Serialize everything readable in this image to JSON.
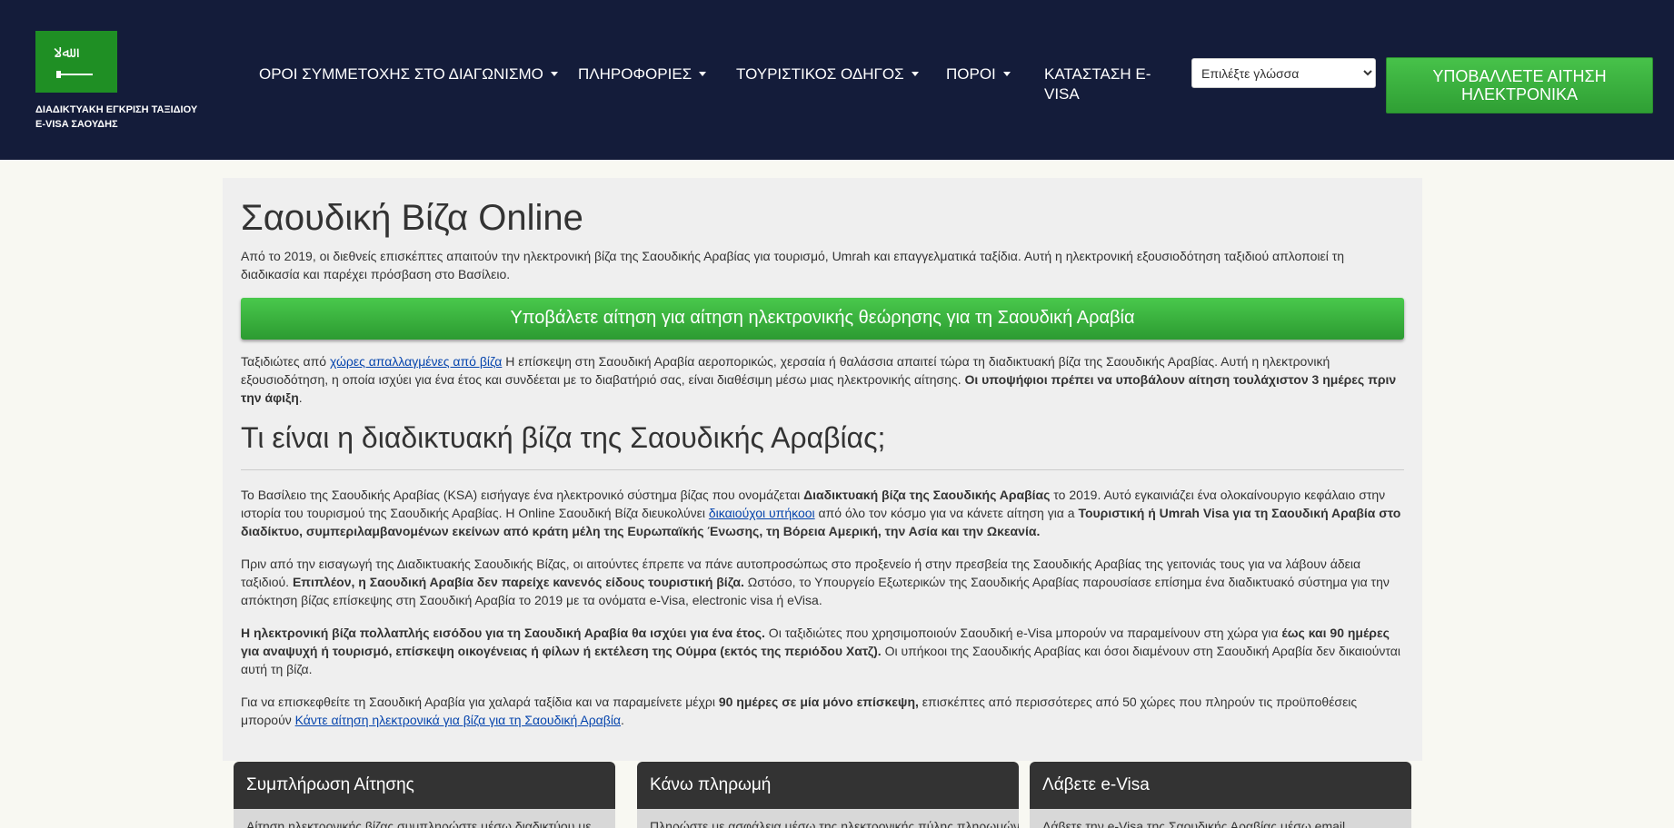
{
  "header": {
    "brand_text": "ΔΙΑΔΙΚΤΥΑΚΗ ΕΓΚΡΙΣΗ ΤΑΞΙΔΙΟΥ E-VISA ΣΑΟΥΔΗΣ",
    "nav": [
      {
        "label": "ΟΡΟΙ ΣΥΜΜΕΤΟΧΗΣ ΣΤΟ ΔΙΑΓΩΝΙΣΜΟ"
      },
      {
        "label": "ΠΛΗΡΟΦΟΡΙΕΣ"
      },
      {
        "label": "ΤΟΥΡΙΣΤΙΚΟΣ ΟΔΗΓΟΣ"
      },
      {
        "label": "ΠΟΡΟΙ"
      },
      {
        "label": "ΚΑΤΑΣΤΑΣΗ E-VISA"
      }
    ],
    "language_select": "Επιλέξτε γλώσσα",
    "apply_button": "ΥΠΟΒΑΛΛΕΤΕ ΑΙΤΗΣΗ ΗΛΕΚΤΡΟΝΙΚΑ",
    "colors": {
      "background": "#141c3a",
      "accent_green": "#35a63a"
    }
  },
  "main": {
    "title": "Σαουδική Βίζα Online",
    "intro": "Από το 2019, οι διεθνείς επισκέπτες απαιτούν την ηλεκτρονική βίζα της Σαουδικής Αραβίας για τουρισμό, Umrah και επαγγελματικά ταξίδια. Αυτή η ηλεκτρονική εξουσιοδότηση ταξιδιού απλοποιεί τη διαδικασία και παρέχει πρόσβαση στο Βασίλειο.",
    "apply_big_button": "Υποβάλετε αίτηση για αίτηση ηλεκτρονικής θεώρησης για τη Σαουδική Αραβία",
    "p2": {
      "pre": "Ταξιδιώτες από ",
      "link": "χώρες απαλλαγμένες από βίζα",
      "mid": " Η επίσκεψη στη Σαουδική Αραβία αεροπορικώς, χερσαία ή θαλάσσια απαιτεί τώρα τη διαδικτυακή βίζα της Σαουδικής Αραβίας. Αυτή η ηλεκτρονική εξουσιοδότηση, η οποία ισχύει για ένα έτος και συνδέεται με το διαβατήριό σας, είναι διαθέσιμη μέσω μιας ηλεκτρονικής αίτησης. ",
      "bold": "Οι υποψήφιοι πρέπει να υποβάλουν αίτηση τουλάχιστον 3 ημέρες πριν την άφιξη",
      "end": "."
    },
    "section_title": "Τι είναι η διαδικτυακή βίζα της Σαουδικής Αραβίας;",
    "p3": {
      "a": "Το Βασίλειο της Σαουδικής Αραβίας (KSA) εισήγαγε ένα ηλεκτρονικό σύστημα βίζας που ονομάζεται ",
      "b_bold": "Διαδικτυακή βίζα της Σαουδικής Αραβίας",
      "c": " το 2019. Αυτό εγκαινιάζει ένα ολοκαίνουργιο κεφάλαιο στην ιστορία του τουρισμού της Σαουδικής Αραβίας. Η Online Σαουδική Βίζα διευκολύνει ",
      "d_link": "δικαιούχοι υπήκοοι",
      "e": " από όλο τον κόσμο για να κάνετε αίτηση για a ",
      "f_bold": "Τουριστική ή Umrah Visa για τη Σαουδική Αραβία στο διαδίκτυο, συμπεριλαμβανομένων εκείνων από κράτη μέλη της Ευρωπαϊκής Ένωσης, τη Βόρεια Αμερική, την Ασία και την Ωκεανία."
    },
    "p4": {
      "a": "Πριν από την εισαγωγή της Διαδικτυακής Σαουδικής Βίζας, οι αιτούντες έπρεπε να πάνε αυτοπροσώπως στο προξενείο ή στην πρεσβεία της Σαουδικής Αραβίας της γειτονιάς τους για να λάβουν άδεια ταξιδιού. ",
      "b_bold": "Επιπλέον, η Σαουδική Αραβία δεν παρείχε κανενός είδους τουριστική βίζα.",
      "c": " Ωστόσο, το Υπουργείο Εξωτερικών της Σαουδικής Αραβίας παρουσίασε επίσημα ένα διαδικτυακό σύστημα για την απόκτηση βίζας επίσκεψης στη Σαουδική Αραβία το 2019 με τα ονόματα e-Visa, electronic visa ή eVisa."
    },
    "p5": {
      "a_bold": "Η ηλεκτρονική βίζα πολλαπλής εισόδου για τη Σαουδική Αραβία θα ισχύει για ένα έτος.",
      "b": " Οι ταξιδιώτες που χρησιμοποιούν Σαουδική e-Visa μπορούν να παραμείνουν στη χώρα για ",
      "c_bold": "έως και 90 ημέρες για αναψυχή ή τουρισμό, επίσκεψη οικογένειας ή φίλων ή εκτέλεση της Ούμρα (εκτός της περιόδου Χατζ).",
      "d": " Οι υπήκοοι της Σαουδικής Αραβίας και όσοι διαμένουν στη Σαουδική Αραβία δεν δικαιούνται αυτή τη βίζα."
    },
    "p6": {
      "a": "Για να επισκεφθείτε τη Σαουδική Αραβία για χαλαρά ταξίδια και να παραμείνετε μέχρι ",
      "b_bold": "90 ημέρες σε μία μόνο επίσκεψη,",
      "c": " επισκέπτες από περισσότερες από 50 χώρες που πληρούν τις προϋποθέσεις μπορούν ",
      "d_link": "Κάντε αίτηση ηλεκτρονικά για βίζα για τη Σαουδική Αραβία",
      "e": "."
    }
  },
  "cards": [
    {
      "title": "Συμπλήρωση Αίτησης",
      "body": "Αίτηση ηλεκτρονικής βίζας συμπληρώστε μέσω διαδικτύου με"
    },
    {
      "title": "Κάνω πληρωμή",
      "body": "Πληρώστε με ασφάλεια μέσω της ηλεκτρονικής πύλης πληρωμών"
    },
    {
      "title": "Λάβετε e-Visa",
      "body": "Λάβετε την e-Visa της Σαουδικής Αραβίας μέσω email"
    }
  ]
}
